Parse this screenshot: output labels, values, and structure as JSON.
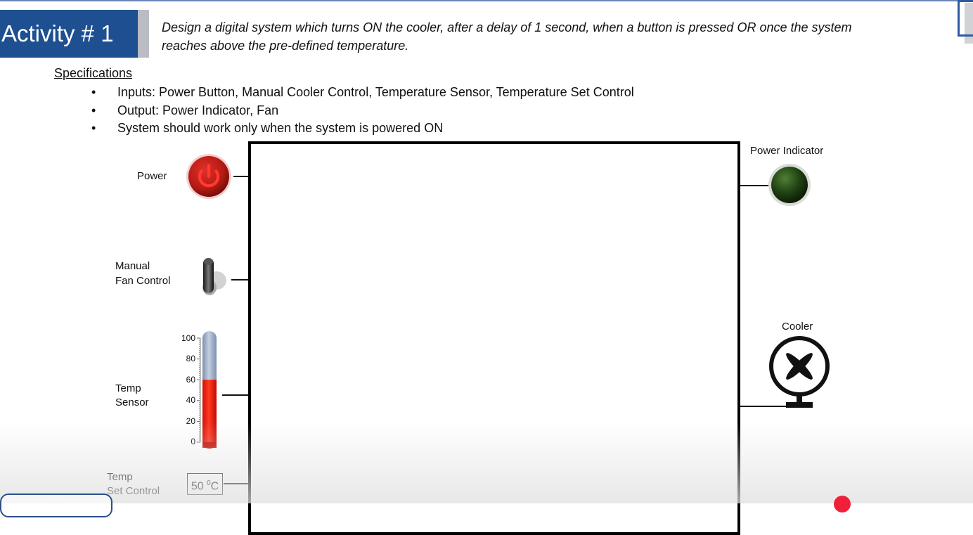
{
  "header": {
    "activity_title": "Activity # 1",
    "task_line1": "Design a digital system which turns ON the cooler, after a delay of 1 second, when a button is pressed OR once the system",
    "task_line2": "reaches above the pre-defined temperature."
  },
  "specifications": {
    "title": "Specifications",
    "items": [
      "Inputs: Power Button, Manual Cooler Control, Temperature Sensor, Temperature Set Control",
      "Output: Power Indicator, Fan",
      "System should work only when the system is powered ON"
    ]
  },
  "inputs": {
    "power_label": "Power",
    "manual_label_line1": "Manual",
    "manual_label_line2": "Fan Control",
    "temp_label_line1": "Temp",
    "temp_label_line2": "Sensor",
    "thermo_ticks": [
      "100",
      "80",
      "60",
      "40",
      "20",
      "0"
    ],
    "thermo_level_percent": 60,
    "set_label_line1": "Temp",
    "set_label_line2": "Set Control",
    "set_value": "50",
    "set_unit_sup": "0",
    "set_unit": "C"
  },
  "outputs": {
    "power_indicator_label": "Power Indicator",
    "cooler_label": "Cooler"
  },
  "colors": {
    "banner_blue": "#1d4f91",
    "power_button_red": "#c0201a",
    "indicator_green": "#1d3d12",
    "thermo_red": "#ff1a0a",
    "thermo_empty": "#9fb1cc"
  },
  "icons": {
    "power": "power-icon",
    "toggle": "toggle-switch-icon",
    "thermometer": "thermometer-icon",
    "indicator": "led-indicator-icon",
    "fan": "fan-icon"
  }
}
